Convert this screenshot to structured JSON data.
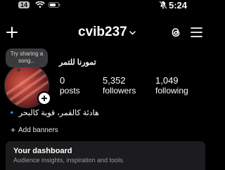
{
  "status_bar": {
    "badge": "14",
    "time": "5:24",
    "icons": [
      "wifi-icon",
      "battery-icon",
      "bell-mute-icon"
    ]
  },
  "header": {
    "username": "cvib237",
    "icons": [
      "add-icon",
      "chevron-down-icon",
      "threads-icon",
      "menu-icon"
    ]
  },
  "profile": {
    "note": "Try sharing a song...",
    "display_name": "تمورنا للتمر",
    "stats": {
      "posts_value": "0",
      "posts_label": "posts",
      "followers_value": "5,352",
      "followers_label": "followers",
      "following_value": "1,049",
      "following_label": "following"
    },
    "bio": "هادئة كالقمر، قوية كالبحر 🔹"
  },
  "banners": {
    "label": "Add banners"
  },
  "dashboard": {
    "title": "Your dashboard",
    "subtitle": "Audience insights, inspiration and tools."
  },
  "colors": {
    "background": "#000000",
    "card": "#1c1c1e",
    "note_bubble": "#3a3a3c",
    "muted_text": "#9a9a9a"
  }
}
